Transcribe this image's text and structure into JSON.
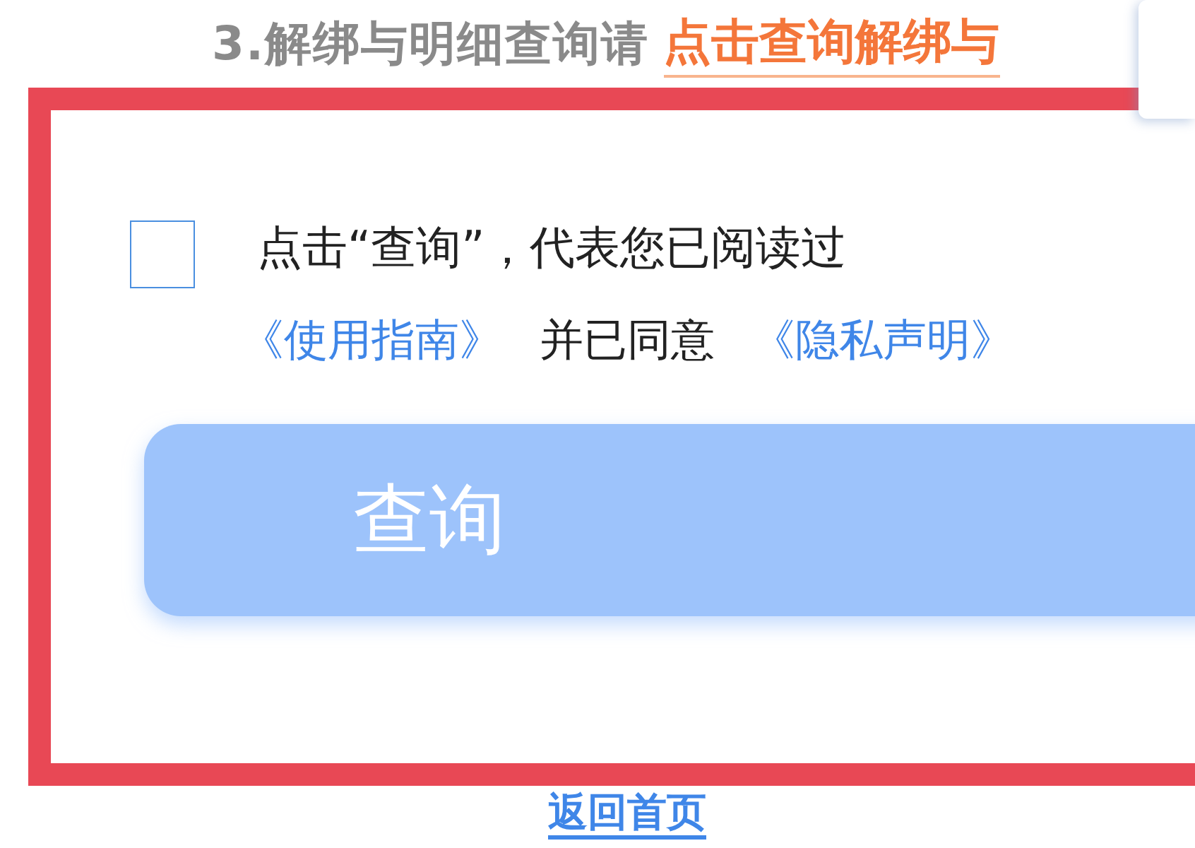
{
  "instruction": {
    "text": "3.解绑与明细查询请",
    "link": "点击查询解绑与"
  },
  "agreement": {
    "checked": false,
    "line1": "点击“查询”，代表您已阅读过",
    "guide_link": "《使用指南》",
    "middle": "并已同意",
    "privacy_link": "《隐私声明》"
  },
  "query_button": {
    "label": "查询",
    "disabled": true
  },
  "home_link": "返回首页"
}
